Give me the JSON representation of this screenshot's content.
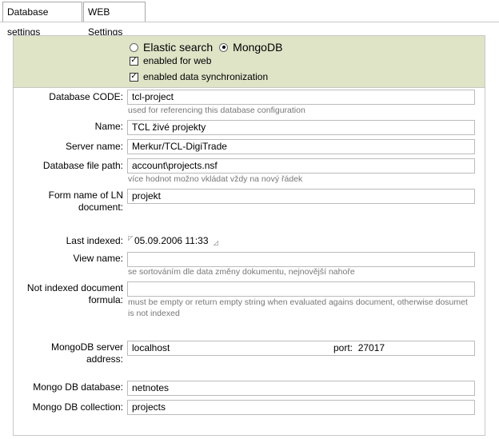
{
  "tabs": {
    "database": "Database settings",
    "web": "WEB Settings"
  },
  "options": {
    "elastic": "Elastic search",
    "mongodb": "MongoDB",
    "enabled_web": "enabled for web",
    "enabled_sync": "enabled data synchronization"
  },
  "form": {
    "db_code_label": "Database CODE:",
    "db_code_value": "tcl-project",
    "db_code_hint": "used for referencing this database configuration",
    "name_label": "Name:",
    "name_value": "TCL živé projekty",
    "server_label": "Server name:",
    "server_value": "Merkur/TCL-DigiTrade",
    "path_label": "Database file path:",
    "path_value": "account\\projects.nsf",
    "path_hint": "více hodnot možno vkládat vždy na nový řádek",
    "form_label": "Form name of LN document:",
    "form_value": "projekt",
    "last_indexed_label": "Last indexed:",
    "last_indexed_value": "05.09.2006 11:33",
    "view_label": "View name:",
    "view_value": "",
    "view_hint": "se sortováním dle data změny dokumentu, nejnovější nahoře",
    "notindexed_label": "Not indexed document formula:",
    "notindexed_value": "",
    "notindexed_hint": "must be empty or return empty string when evaluated agains document, otherwise dosumet is not indexed",
    "mongo_server_label": "MongoDB server address:",
    "mongo_server_value": "localhost",
    "port_label": "port:",
    "port_value": "27017",
    "mongo_db_label": "Mongo DB database:",
    "mongo_db_value": "netnotes",
    "mongo_coll_label": "Mongo DB collection:",
    "mongo_coll_value": "projects"
  }
}
